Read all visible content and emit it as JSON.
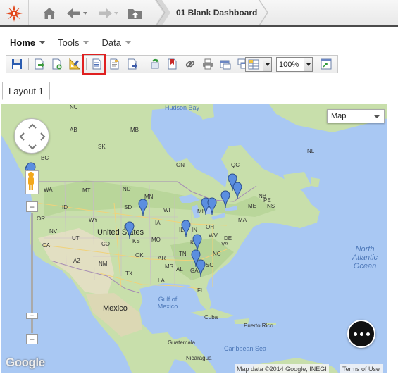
{
  "header": {
    "dashboard_title": "01 Blank Dashboard",
    "icons": [
      "starburst-logo-icon",
      "home-icon",
      "back-icon",
      "forward-icon",
      "upload-icon"
    ]
  },
  "menu": {
    "items": [
      {
        "label": "Home"
      },
      {
        "label": "Tools"
      },
      {
        "label": "Data"
      }
    ]
  },
  "toolbar": {
    "zoom_value": "100%",
    "highlight_color": "#e02020"
  },
  "tabs": [
    {
      "label": "Layout 1"
    }
  ],
  "map": {
    "map_type": "Map",
    "google_logo": "Google",
    "attribution": "Map data ©2014 Google, INEGI",
    "terms": "Terms of Use",
    "zoom_in": "+",
    "zoom_out": "−",
    "zoom_out_extra": "−",
    "labels": {
      "hudson_bay": "Hudson Bay",
      "united_states": "United States",
      "mexico": "Mexico",
      "cuba": "Cuba",
      "puerto_rico": "Puerto Rico",
      "guatemala": "Guatemala",
      "nicaragua": "Nicaragua",
      "caribbean": "Caribbean Sea",
      "gulf_line1": "Gulf of",
      "gulf_line2": "Mexico",
      "ocean_line1": "North",
      "ocean_line2": "Atlantic",
      "ocean_line3": "Ocean",
      "nu": "NU",
      "ab": "AB",
      "sk": "SK",
      "mb": "MB",
      "bc": "BC",
      "on": "ON",
      "qc": "QC",
      "nl": "NL",
      "nb": "NB",
      "ns": "NS",
      "pe": "PE",
      "wa": "WA",
      "mt": "MT",
      "nd": "ND",
      "mn": "MN",
      "id": "ID",
      "wy": "WY",
      "sd": "SD",
      "wi": "WI",
      "mi": "MI",
      "or": "OR",
      "nv": "NV",
      "ut": "UT",
      "co": "CO",
      "ne": "NE",
      "ia": "IA",
      "il": "IL",
      "in": "IN",
      "oh": "OH",
      "ca": "CA",
      "az": "AZ",
      "nm": "NM",
      "ks": "KS",
      "mo": "MO",
      "ok": "OK",
      "ar": "AR",
      "tn": "TN",
      "ky": "KY",
      "wv": "WV",
      "va": "VA",
      "nc": "NC",
      "sc": "SC",
      "ga": "GA",
      "al": "AL",
      "ms": "MS",
      "la": "LA",
      "tx": "TX",
      "fl": "FL",
      "me": "ME",
      "ma": "MA",
      "de": "DE"
    },
    "pin_color": "#5b8ee0",
    "pin_count": 13
  }
}
